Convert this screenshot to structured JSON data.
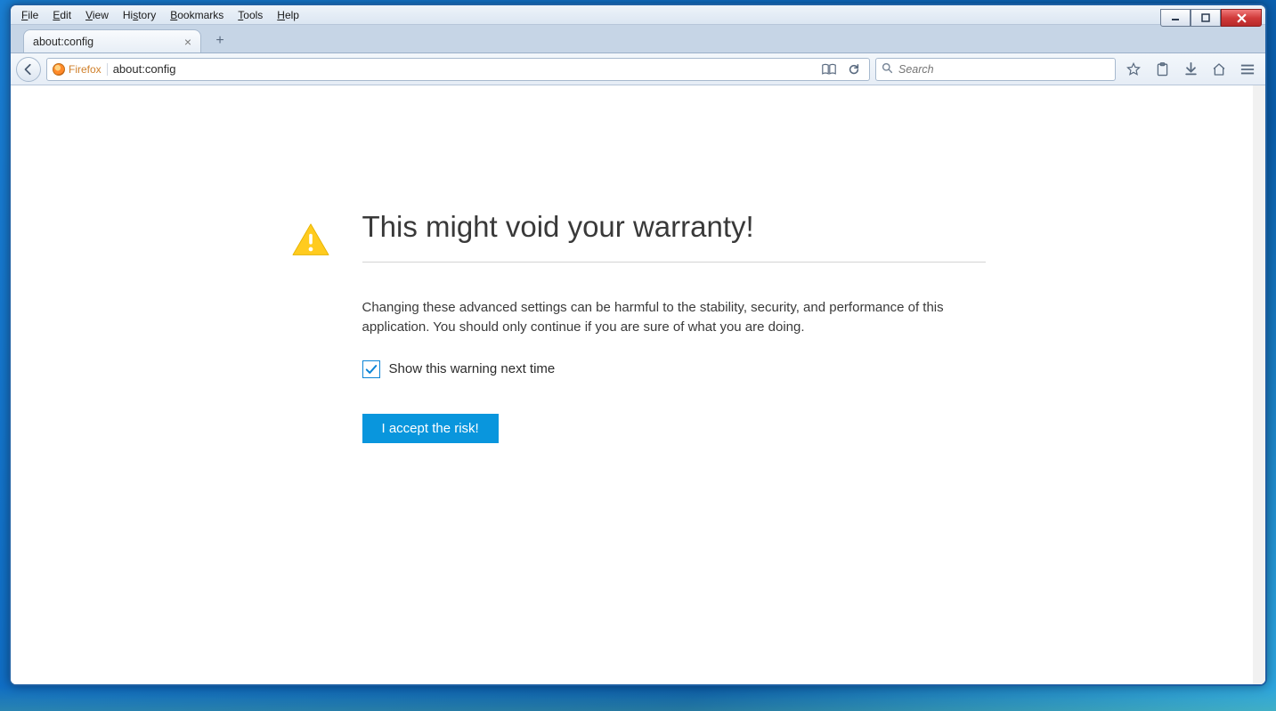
{
  "menubar": {
    "items": [
      {
        "label": "File",
        "accel": "F"
      },
      {
        "label": "Edit",
        "accel": "E"
      },
      {
        "label": "View",
        "accel": "V"
      },
      {
        "label": "History",
        "accel": "Hi"
      },
      {
        "label": "Bookmarks",
        "accel": "B"
      },
      {
        "label": "Tools",
        "accel": "T"
      },
      {
        "label": "Help",
        "accel": "H"
      }
    ]
  },
  "tabs": {
    "active": {
      "title": "about:config"
    }
  },
  "nav": {
    "identity_label": "Firefox",
    "url": "about:config",
    "search_placeholder": "Search"
  },
  "page": {
    "heading": "This might void your warranty!",
    "paragraph": "Changing these advanced settings can be harmful to the stability, security, and performance of this application. You should only continue if you are sure of what you are doing.",
    "checkbox_label": "Show this warning next time",
    "checkbox_checked": true,
    "accept_button": "I accept the risk!"
  }
}
